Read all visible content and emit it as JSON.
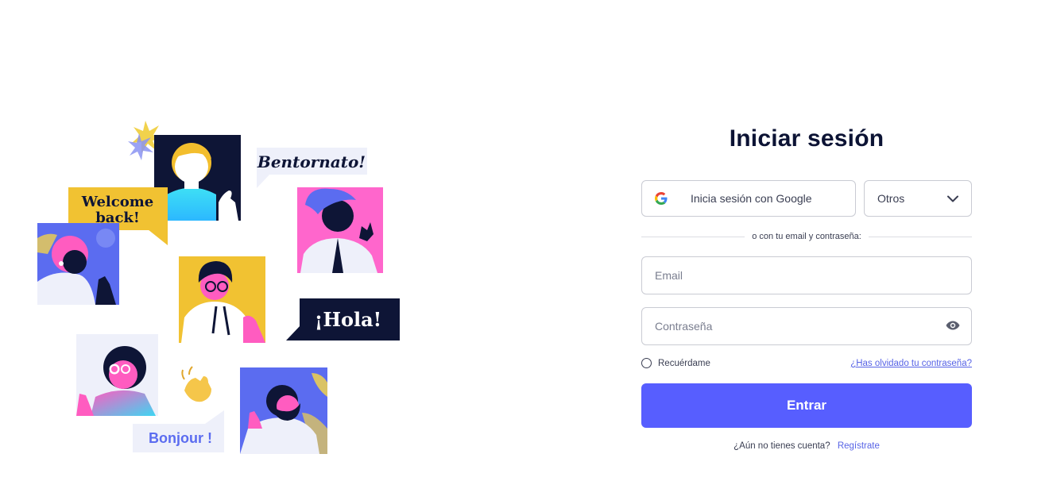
{
  "illustration": {
    "bubbles": {
      "bentornato": "Bentornato!",
      "welcome_line1": "Welcome",
      "welcome_line2": "back!",
      "hola": "¡Hola!",
      "bonjour": "Bonjour !"
    },
    "colors": {
      "navy": "#0e1536",
      "yellow": "#f1c232",
      "pink": "#ff5cc0",
      "blue": "#5b6cf0",
      "cyan": "#33d6f0",
      "light": "#eef0fa"
    }
  },
  "login": {
    "title": "Iniciar sesión",
    "google_button": "Inicia sesión con Google",
    "google_icon": "google-g-icon",
    "others_select": "Otros",
    "others_icon": "chevron-down-icon",
    "divider_text": "o con tu email y contraseña:",
    "email_placeholder": "Email",
    "password_placeholder": "Contraseña",
    "password_icon": "eye-icon",
    "remember_label": "Recuérdame",
    "forgot_link": "¿Has olvidado tu contraseña?",
    "submit_label": "Entrar",
    "signup_prompt": "¿Aún no tienes cuenta?",
    "signup_link": "Regístrate"
  },
  "colors": {
    "primary": "#575eff",
    "link": "#5763e6",
    "heading": "#0c1334",
    "border": "#c9cbd3"
  }
}
